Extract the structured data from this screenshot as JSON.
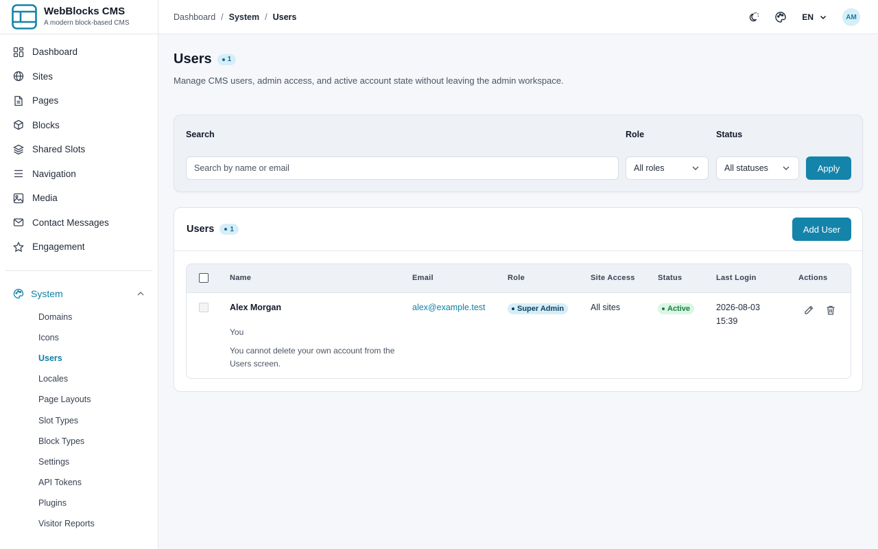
{
  "brand": {
    "name": "WebBlocks CMS",
    "tagline": "A modern block-based CMS"
  },
  "nav": {
    "items": [
      {
        "label": "Dashboard",
        "icon": "grid-icon"
      },
      {
        "label": "Sites",
        "icon": "globe-icon"
      },
      {
        "label": "Pages",
        "icon": "file-icon"
      },
      {
        "label": "Blocks",
        "icon": "cube-icon"
      },
      {
        "label": "Shared Slots",
        "icon": "layers-icon"
      },
      {
        "label": "Navigation",
        "icon": "menu-icon"
      },
      {
        "label": "Media",
        "icon": "image-icon"
      },
      {
        "label": "Contact Messages",
        "icon": "mail-icon"
      },
      {
        "label": "Engagement",
        "icon": "star-icon"
      }
    ],
    "system": {
      "label": "System",
      "items": [
        "Domains",
        "Icons",
        "Users",
        "Locales",
        "Page Layouts",
        "Slot Types",
        "Block Types",
        "Settings",
        "API Tokens",
        "Plugins",
        "Visitor Reports"
      ],
      "active": "Users"
    }
  },
  "breadcrumb": {
    "root": "Dashboard",
    "parent": "System",
    "current": "Users"
  },
  "topbar": {
    "lang": "EN",
    "avatar": "AM"
  },
  "page": {
    "title": "Users",
    "count": "1",
    "subtitle": "Manage CMS users, admin access, and active account state without leaving the admin workspace."
  },
  "filters": {
    "search_label": "Search",
    "search_placeholder": "Search by name or email",
    "role_label": "Role",
    "role_value": "All roles",
    "status_label": "Status",
    "status_value": "All statuses",
    "apply_label": "Apply"
  },
  "users_card": {
    "title": "Users",
    "count": "1",
    "add_label": "Add User",
    "columns": [
      "Name",
      "Email",
      "Role",
      "Site Access",
      "Status",
      "Last Login",
      "Actions"
    ],
    "rows": [
      {
        "name": "Alex Morgan",
        "note": "You",
        "warning": "You cannot delete your own account from the Users screen.",
        "email": "alex@example.test",
        "role": "Super Admin",
        "site_access": "All sites",
        "status": "Active",
        "last_login_date": "2026-08-03",
        "last_login_time": "15:39"
      }
    ]
  },
  "colors": {
    "accent": "#1484aa",
    "role_badge": "#d6eef8",
    "status_badge": "#dcf5e4",
    "status_text": "#15803d"
  }
}
